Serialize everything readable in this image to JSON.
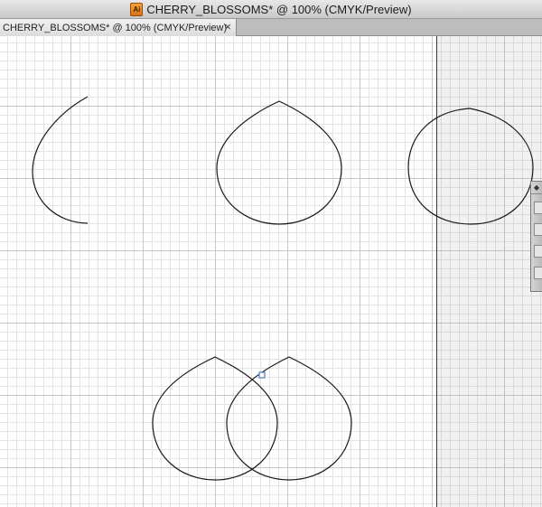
{
  "window": {
    "title": "CHERRY_BLOSSOMS* @ 100% (CMYK/Preview)",
    "app_icon_text": "Ai"
  },
  "tab": {
    "label": "CHERRY_BLOSSOMS* @ 100% (CMYK/Preview)",
    "close_glyph": "×"
  },
  "panel": {
    "grip_glyph": "◆"
  },
  "colors": {
    "stroke": "#1a1a1a",
    "anchor_point": "#4a7fc4"
  }
}
